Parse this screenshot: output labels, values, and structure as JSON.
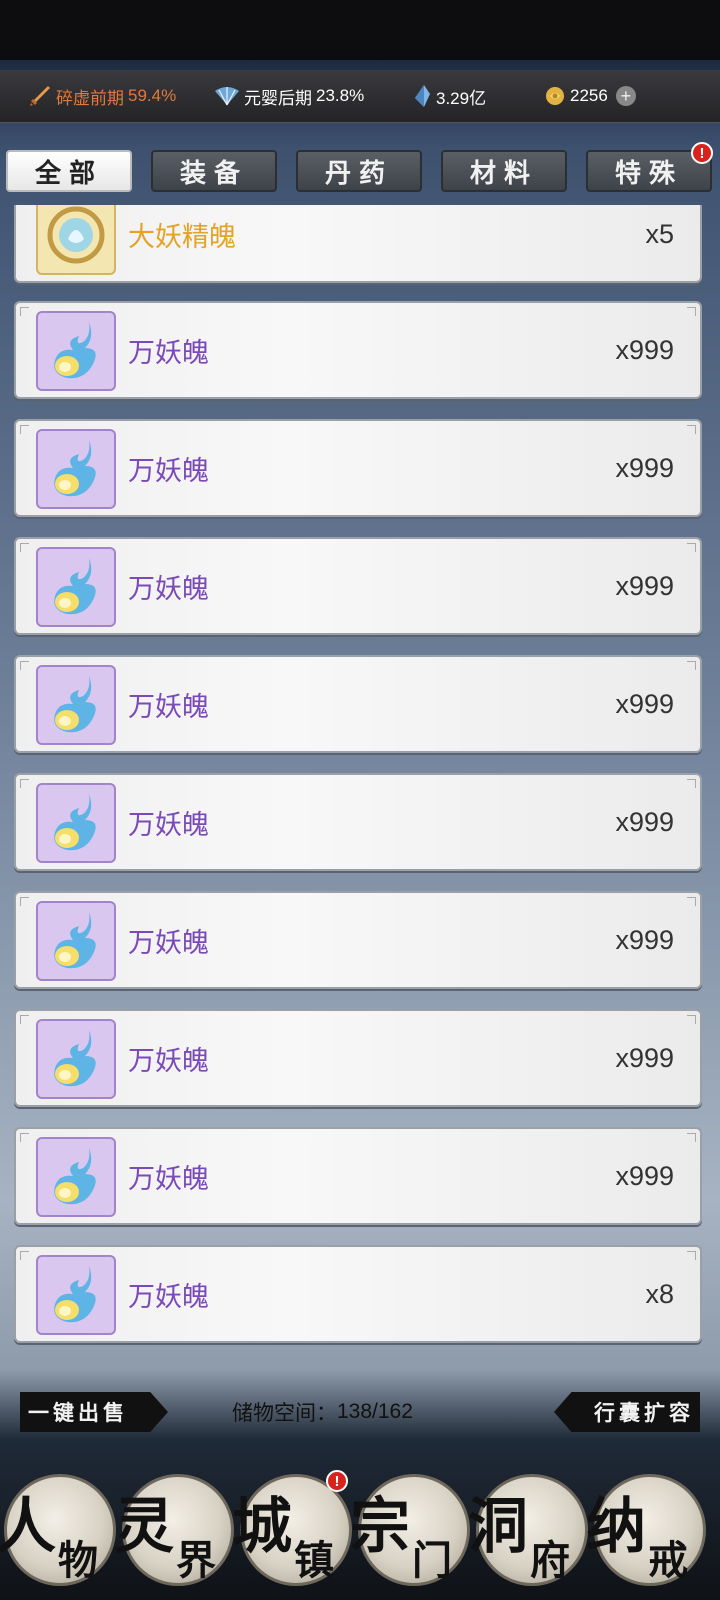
{
  "resources": {
    "cultivation": {
      "label": "碎虚前期",
      "percent": "59.4%"
    },
    "secondary": {
      "label": "元婴后期",
      "percent": "23.8%"
    },
    "spirit_stones": "3.29亿",
    "currency": "2256",
    "plus_label": "+"
  },
  "tabs": [
    "全部",
    "装备",
    "丹药",
    "材料",
    "特殊"
  ],
  "tab_badge": "!",
  "items": [
    {
      "name": "大妖精魄",
      "qty": "x5",
      "rarity": "gold"
    },
    {
      "name": "万妖魄",
      "qty": "x999",
      "rarity": "purple"
    },
    {
      "name": "万妖魄",
      "qty": "x999",
      "rarity": "purple"
    },
    {
      "name": "万妖魄",
      "qty": "x999",
      "rarity": "purple"
    },
    {
      "name": "万妖魄",
      "qty": "x999",
      "rarity": "purple"
    },
    {
      "name": "万妖魄",
      "qty": "x999",
      "rarity": "purple"
    },
    {
      "name": "万妖魄",
      "qty": "x999",
      "rarity": "purple"
    },
    {
      "name": "万妖魄",
      "qty": "x999",
      "rarity": "purple"
    },
    {
      "name": "万妖魄",
      "qty": "x999",
      "rarity": "purple"
    },
    {
      "name": "万妖魄",
      "qty": "x8",
      "rarity": "purple"
    }
  ],
  "actions": {
    "sell_all": "一键出售",
    "expand": "行囊扩容"
  },
  "storage": {
    "label": "储物空间：",
    "value": "138/162"
  },
  "nav": [
    {
      "c1": "人",
      "c2": "物"
    },
    {
      "c1": "灵",
      "c2": "界"
    },
    {
      "c1": "城",
      "c2": "镇"
    },
    {
      "c1": "宗",
      "c2": "门"
    },
    {
      "c1": "洞",
      "c2": "府"
    },
    {
      "c1": "纳",
      "c2": "戒"
    }
  ],
  "nav_badge": "!",
  "colors": {
    "rare_purple": "#7a4ab8",
    "rare_gold": "#e4a325",
    "accent_orange": "#e07a3a",
    "badge_red": "#d8231d"
  }
}
